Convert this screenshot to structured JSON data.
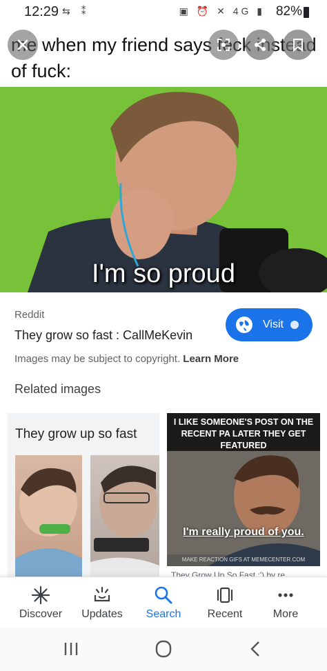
{
  "status_bar": {
    "time": "12:29",
    "left_icons": [
      "sync-icon",
      "data-icon"
    ],
    "right_icons": [
      "nfc-icon",
      "alarm-icon",
      "mute-icon",
      "4g-icon",
      "signal-icon"
    ],
    "battery": "82%"
  },
  "viewer": {
    "caption": "me when my friend says feck instead of fuck:",
    "image_overlay_text": "I'm so proud",
    "buttons": {
      "close": "close-icon",
      "lens": "lens-icon",
      "share": "share-icon",
      "save": "bookmark-icon"
    }
  },
  "result": {
    "source": "Reddit",
    "title": "They grow so fast : CallMeKevin",
    "visit_label": "Visit",
    "copyright_notice": "Images may be subject to copyright.",
    "learn_more": "Learn More"
  },
  "related": {
    "heading": "Related images",
    "items": [
      {
        "title_text": "They grow up so fast"
      },
      {
        "meme_top": "I LIKE SOMEONE'S POST ON THE RECENT PA LATER THEY GET FEATURED",
        "meme_caption": "I'm really proud of you.",
        "meme_footer": "MAKE REACTION GIFS AT MEMECENTER.COM",
        "subtitle": "They Grow Up So Fast :') by re..."
      }
    ]
  },
  "bottom_nav": {
    "items": [
      {
        "label": "Discover",
        "icon": "asterisk-icon",
        "active": false
      },
      {
        "label": "Updates",
        "icon": "updates-icon",
        "active": false
      },
      {
        "label": "Search",
        "icon": "search-icon",
        "active": true
      },
      {
        "label": "Recent",
        "icon": "recent-icon",
        "active": false
      },
      {
        "label": "More",
        "icon": "more-dots-icon",
        "active": false
      }
    ]
  },
  "colors": {
    "accent": "#1a73e8",
    "image_bg": "#7cc43c"
  }
}
